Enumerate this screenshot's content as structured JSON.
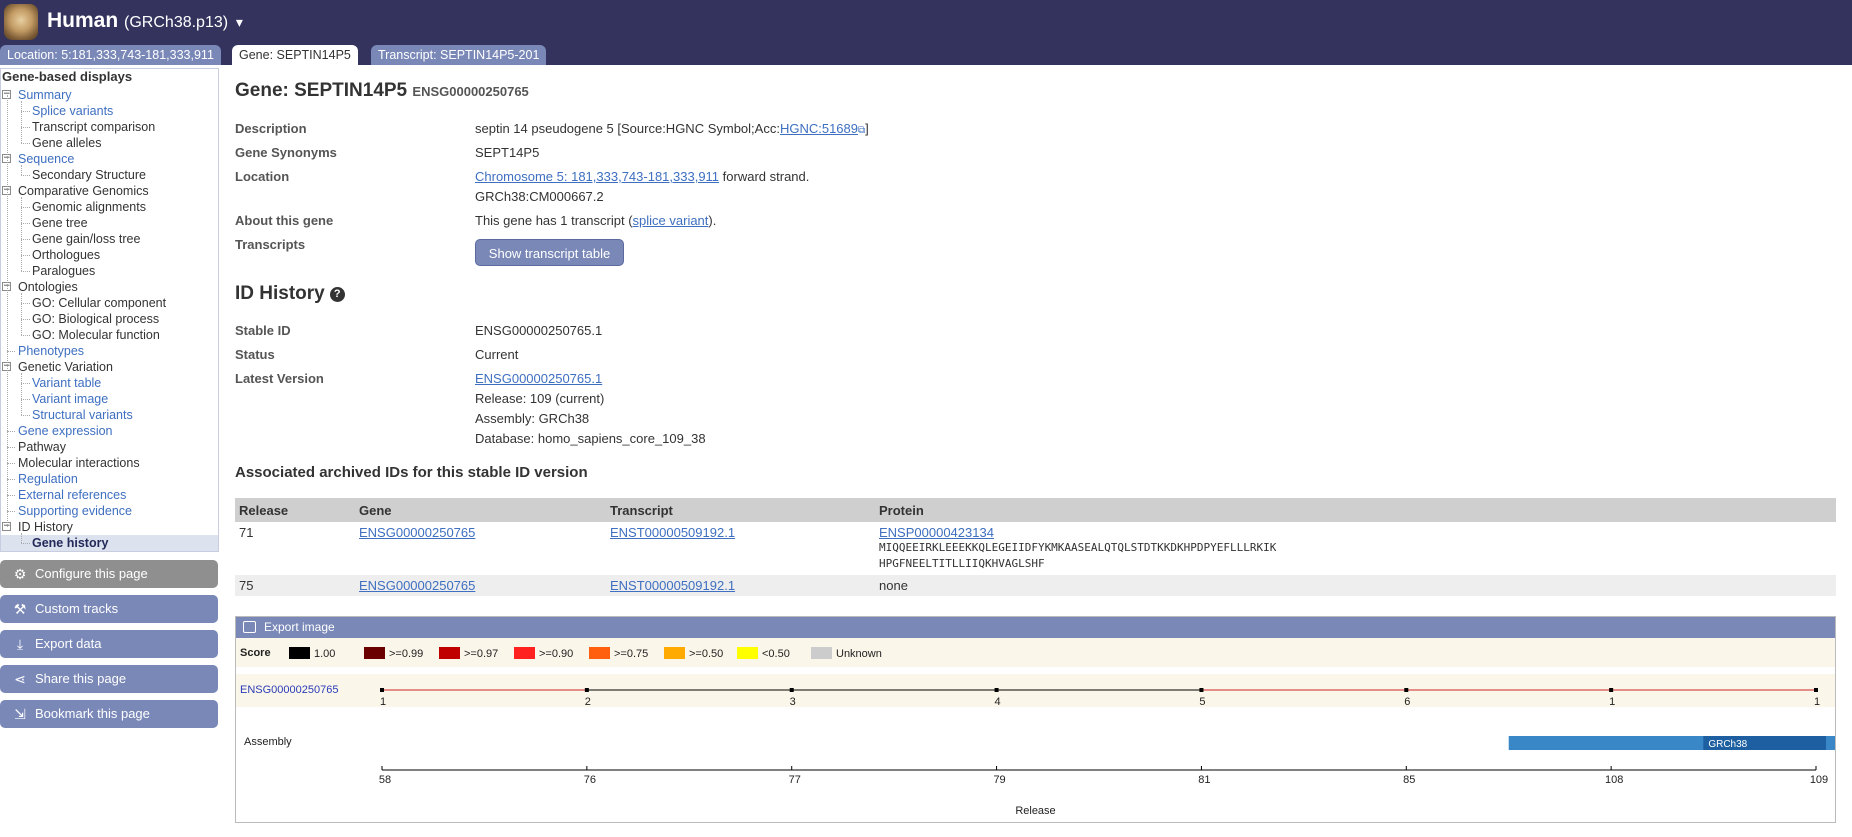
{
  "header": {
    "species": "Human",
    "assembly": "(GRCh38.p13)",
    "caret": "▾",
    "logo_icon": "human-portrait-logo",
    "background": "#33335e"
  },
  "tabs": [
    {
      "label": "Location: 5:181,333,743-181,333,911",
      "active": false
    },
    {
      "label": "Gene: SEPTIN14P5",
      "active": true
    },
    {
      "label": "Transcript: SEPTIN14P5-201",
      "active": false
    }
  ],
  "sidebar": {
    "heading": "Gene-based displays",
    "items": [
      {
        "label": "Summary",
        "level": 0,
        "link": true,
        "toggle": "−"
      },
      {
        "label": "Splice variants",
        "level": 1,
        "link": true
      },
      {
        "label": "Transcript comparison",
        "level": 1,
        "link": false
      },
      {
        "label": "Gene alleles",
        "level": 1,
        "link": false
      },
      {
        "label": "Sequence",
        "level": 0,
        "link": true,
        "toggle": "−"
      },
      {
        "label": "Secondary Structure",
        "level": 1,
        "link": false
      },
      {
        "label": "Comparative Genomics",
        "level": 0,
        "link": false,
        "toggle": "−"
      },
      {
        "label": "Genomic alignments",
        "level": 1,
        "link": false
      },
      {
        "label": "Gene tree",
        "level": 1,
        "link": false
      },
      {
        "label": "Gene gain/loss tree",
        "level": 1,
        "link": false
      },
      {
        "label": "Orthologues",
        "level": 1,
        "link": false
      },
      {
        "label": "Paralogues",
        "level": 1,
        "link": false
      },
      {
        "label": "Ontologies",
        "level": 0,
        "link": false,
        "toggle": "−"
      },
      {
        "label": "GO: Cellular component",
        "level": 1,
        "link": false
      },
      {
        "label": "GO: Biological process",
        "level": 1,
        "link": false
      },
      {
        "label": "GO: Molecular function",
        "level": 1,
        "link": false
      },
      {
        "label": "Phenotypes",
        "level": 0,
        "link": true
      },
      {
        "label": "Genetic Variation",
        "level": 0,
        "link": false,
        "toggle": "−"
      },
      {
        "label": "Variant table",
        "level": 1,
        "link": true
      },
      {
        "label": "Variant image",
        "level": 1,
        "link": true
      },
      {
        "label": "Structural variants",
        "level": 1,
        "link": true
      },
      {
        "label": "Gene expression",
        "level": 0,
        "link": true
      },
      {
        "label": "Pathway",
        "level": 0,
        "link": false
      },
      {
        "label": "Molecular interactions",
        "level": 0,
        "link": false
      },
      {
        "label": "Regulation",
        "level": 0,
        "link": true
      },
      {
        "label": "External references",
        "level": 0,
        "link": true
      },
      {
        "label": "Supporting evidence",
        "level": 0,
        "link": true
      },
      {
        "label": "ID History",
        "level": 0,
        "link": false,
        "toggle": "−"
      },
      {
        "label": "Gene history",
        "level": 1,
        "link": false,
        "active": true
      }
    ]
  },
  "tools": [
    {
      "label": "Configure this page",
      "icon": "gear-icon"
    },
    {
      "label": "Custom tracks",
      "icon": "custom-tracks-icon"
    },
    {
      "label": "Export data",
      "icon": "export-icon"
    },
    {
      "label": "Share this page",
      "icon": "share-icon"
    },
    {
      "label": "Bookmark this page",
      "icon": "bookmark-icon"
    }
  ],
  "gene": {
    "title": "Gene: SEPTIN14P5",
    "id": "ENSG00000250765",
    "rows": {
      "description_label": "Description",
      "description_text": "septin 14 pseudogene 5 [Source:HGNC Symbol;Acc:",
      "description_link": "HGNC:51689",
      "description_end": "]",
      "synonyms_label": "Gene Synonyms",
      "synonyms_value": "SEPT14P5",
      "location_label": "Location",
      "location_link": "Chromosome 5: 181,333,743-181,333,911",
      "location_strand": "forward strand.",
      "location_alt": "GRCh38:CM000667.2",
      "about_label": "About this gene",
      "about_text": "This gene has 1 transcript (",
      "about_link": "splice variant",
      "about_end": ").",
      "transcripts_label": "Transcripts",
      "transcripts_button": "Show transcript table"
    }
  },
  "id_history": {
    "title": "ID History",
    "help": "?",
    "stable_id_label": "Stable ID",
    "stable_id_value": "ENSG00000250765.1",
    "status_label": "Status",
    "status_value": "Current",
    "latest_label": "Latest Version",
    "latest_link": "ENSG00000250765.1",
    "release": "Release: 109 (current)",
    "assembly": "Assembly: GRCh38",
    "database": "Database: homo_sapiens_core_109_38"
  },
  "archived": {
    "title": "Associated archived IDs for this stable ID version",
    "headers": [
      "Release",
      "Gene",
      "Transcript",
      "Protein"
    ],
    "rows": [
      {
        "release": "71",
        "gene": "ENSG00000250765",
        "transcript": "ENST00000509192.1",
        "protein": "ENSP00000423134",
        "seq1": "MIQQEEIRKLEEEKKQLEGEIIDFYKMKAASEALQTQLSTDTKKDKHPDPYEFLLLRKIK",
        "seq2": "HPGFNEELTITLLIIQKHVAGLSHF"
      },
      {
        "release": "75",
        "gene": "ENSG00000250765",
        "transcript": "ENST00000509192.1",
        "protein": "none"
      }
    ]
  },
  "export": {
    "label": "Export image",
    "icon": "image-icon"
  },
  "chart_data": {
    "type": "line",
    "legend_title": "Score",
    "legend": [
      {
        "label": "1.00",
        "color": "#000000"
      },
      {
        "label": ">=0.99",
        "color": "#6b0000"
      },
      {
        "label": ">=0.97",
        "color": "#c00000"
      },
      {
        "label": ">=0.90",
        "color": "#ff2020"
      },
      {
        "label": ">=0.75",
        "color": "#ff6010"
      },
      {
        "label": ">=0.50",
        "color": "#ffaa00"
      },
      {
        "label": "<0.50",
        "color": "#ffff00"
      },
      {
        "label": "Unknown",
        "color": "#cccccc"
      }
    ],
    "track_label": "ENSG00000250765",
    "track_points": [
      "1",
      "2",
      "3",
      "4",
      "5",
      "6",
      "1",
      "1"
    ],
    "segment_colors": [
      "#cc2222",
      "#000000",
      "#000000",
      "#000000",
      "#cc2222",
      "#cc2222",
      "#cc2222"
    ],
    "assembly_label": "Assembly",
    "assembly_bar": {
      "label": "GRCh38",
      "start": "85",
      "end": "109"
    },
    "x_ticks": [
      "58",
      "76",
      "77",
      "79",
      "81",
      "85",
      "108",
      "109"
    ],
    "xlabel": "Release"
  }
}
